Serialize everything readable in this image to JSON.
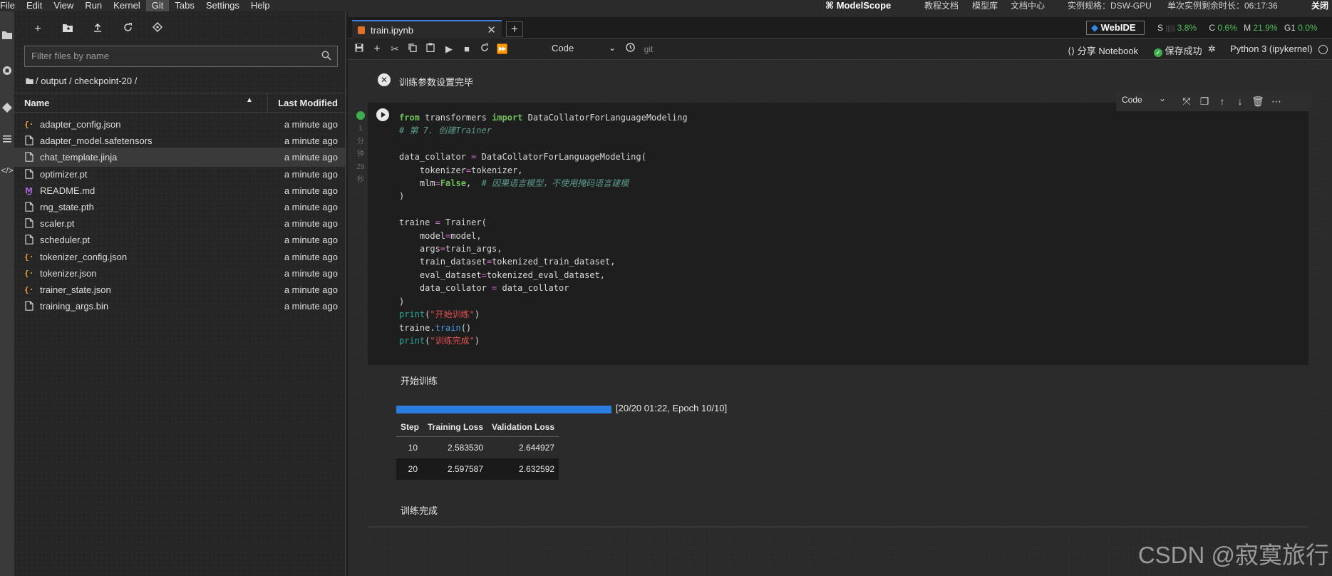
{
  "menubar": {
    "items": [
      "File",
      "Edit",
      "View",
      "Run",
      "Kernel",
      "Git",
      "Tabs",
      "Settings",
      "Help"
    ],
    "brand": "ModelScope",
    "links": [
      "教程文档",
      "模型库",
      "文档中心"
    ],
    "instance_spec": "实例规格：DSW-GPU",
    "remaining_time": "单次实例剩余时长：06:17:36",
    "close_label": "关闭"
  },
  "file_browser": {
    "filter_placeholder": "Filter files by name",
    "breadcrumb": "/ output / checkpoint-20 /",
    "col_name": "Name",
    "col_modified": "Last Modified",
    "files": [
      {
        "name": "adapter_config.json",
        "modified": "a minute ago",
        "icon": "json-icon"
      },
      {
        "name": "adapter_model.safetensors",
        "modified": "a minute ago",
        "icon": "file-icon"
      },
      {
        "name": "chat_template.jinja",
        "modified": "a minute ago",
        "icon": "file-icon"
      },
      {
        "name": "optimizer.pt",
        "modified": "a minute ago",
        "icon": "file-icon"
      },
      {
        "name": "README.md",
        "modified": "a minute ago",
        "icon": "markdown-icon"
      },
      {
        "name": "rng_state.pth",
        "modified": "a minute ago",
        "icon": "file-icon"
      },
      {
        "name": "scaler.pt",
        "modified": "a minute ago",
        "icon": "file-icon"
      },
      {
        "name": "scheduler.pt",
        "modified": "a minute ago",
        "icon": "file-icon"
      },
      {
        "name": "tokenizer_config.json",
        "modified": "a minute ago",
        "icon": "json-icon"
      },
      {
        "name": "tokenizer.json",
        "modified": "a minute ago",
        "icon": "json-icon"
      },
      {
        "name": "trainer_state.json",
        "modified": "a minute ago",
        "icon": "json-icon"
      },
      {
        "name": "training_args.bin",
        "modified": "a minute ago",
        "icon": "file-icon"
      }
    ]
  },
  "editor": {
    "tab_label": "train.ipynb",
    "cell_type": "Code",
    "git_label": "git",
    "webide_label": "WebIDE",
    "metrics": {
      "s_label": "S",
      "s_value": "3.8%",
      "c_label": "C",
      "c_value": "0.6%",
      "m_label": "M",
      "m_value": "21.9%",
      "g_label": "G1",
      "g_value": "0.0%"
    },
    "share_label": "分享 Notebook",
    "save_status": "保存成功",
    "kernel_label": "Python 3 (ipykernel)"
  },
  "cells": {
    "prev_output": "训练参数设置完毕",
    "cell_type": "Code",
    "exec_time": [
      "1",
      "分",
      "钟",
      "29",
      "秒"
    ],
    "output_start": "开始训练",
    "progress_label": "[20/20 01:22, Epoch 10/10]",
    "progress_fraction": 1.0,
    "table_headers": [
      "Step",
      "Training Loss",
      "Validation Loss"
    ],
    "table_rows": [
      [
        "10",
        "2.583530",
        "2.644927"
      ],
      [
        "20",
        "2.597587",
        "2.632592"
      ]
    ],
    "output_done": "训练完成"
  },
  "watermark": "CSDN @寂寞旅行"
}
